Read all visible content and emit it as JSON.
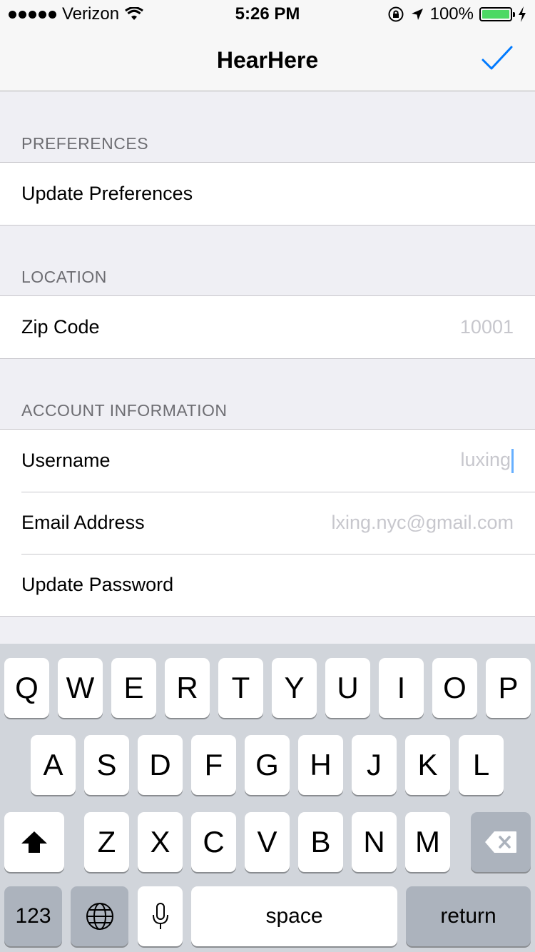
{
  "status_bar": {
    "carrier": "Verizon",
    "time": "5:26 PM",
    "battery": "100%"
  },
  "nav": {
    "title": "HearHere",
    "done_icon": "checkmark-icon"
  },
  "sections": {
    "preferences": {
      "header": "PREFERENCES",
      "rows": {
        "update_preferences": "Update Preferences"
      }
    },
    "location": {
      "header": "LOCATION",
      "rows": {
        "zip_label": "Zip Code",
        "zip_placeholder": "10001"
      }
    },
    "account": {
      "header": "ACCOUNT INFORMATION",
      "rows": {
        "username_label": "Username",
        "username_value": "luxing",
        "email_label": "Email Address",
        "email_value": "lxing.nyc@gmail.com",
        "password_label": "Update Password"
      }
    }
  },
  "keyboard": {
    "row1": [
      "Q",
      "W",
      "E",
      "R",
      "T",
      "Y",
      "U",
      "I",
      "O",
      "P"
    ],
    "row2": [
      "A",
      "S",
      "D",
      "F",
      "G",
      "H",
      "J",
      "K",
      "L"
    ],
    "row3": [
      "Z",
      "X",
      "C",
      "V",
      "B",
      "N",
      "M"
    ],
    "numbers": "123",
    "space": "space",
    "return": "return"
  },
  "colors": {
    "accent": "#007aff",
    "battery": "#4cd964"
  }
}
